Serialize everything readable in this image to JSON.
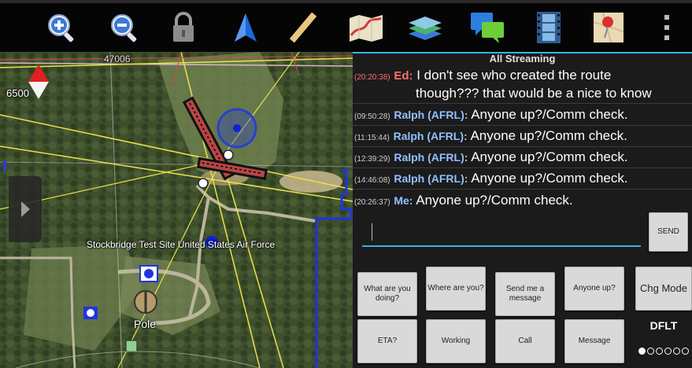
{
  "toolbar": {
    "icons": [
      "zoom-in-icon",
      "zoom-out-icon",
      "lock-icon",
      "navigation-arrow-icon",
      "measure-ruler-icon",
      "route-map-icon",
      "layers-icon",
      "chat-icon",
      "video-icon",
      "map-pin-icon",
      "overflow-menu-icon"
    ]
  },
  "map": {
    "grid_label": "47006",
    "scale_label": "6500",
    "site_label": "Stockbridge Test Site United States Air Force",
    "pole_label": "Pole"
  },
  "chat": {
    "title": "All Streaming",
    "messages": [
      {
        "time": "(20:20:38)",
        "from": "Ed:",
        "text1": "I don't see who created the route",
        "text2": "though??? that would be a nice to know"
      },
      {
        "time": "(09:50:28)",
        "from": "Ralph (AFRL):",
        "text": "Anyone up?/Comm check."
      },
      {
        "time": "(11:15:44)",
        "from": "Ralph (AFRL):",
        "text": "Anyone up?/Comm check."
      },
      {
        "time": "(12:39:29)",
        "from": "Ralph (AFRL):",
        "text": "Anyone up?/Comm check."
      },
      {
        "time": "(14:46:08)",
        "from": "Ralph (AFRL):",
        "text": "Anyone up?/Comm check."
      },
      {
        "time": "(20:26:37)",
        "from": "Me:",
        "text": "Anyone up?/Comm check."
      }
    ],
    "input_value": "",
    "send_label": "SEND",
    "quick_buttons_row1": [
      "What are you doing?",
      "Where are you?",
      "Send me a message",
      "Anyone up?"
    ],
    "quick_buttons_row2": [
      "ETA?",
      "Working",
      "Call",
      "Message"
    ],
    "chg_mode_label": "Chg Mode",
    "mode_label": "DFLT",
    "page_indicator": {
      "pages": 6,
      "current": 1
    }
  },
  "colors": {
    "accent": "#33b5e5",
    "ed_name": "#ff6e6e",
    "ralph_name": "#8fc3ff"
  }
}
